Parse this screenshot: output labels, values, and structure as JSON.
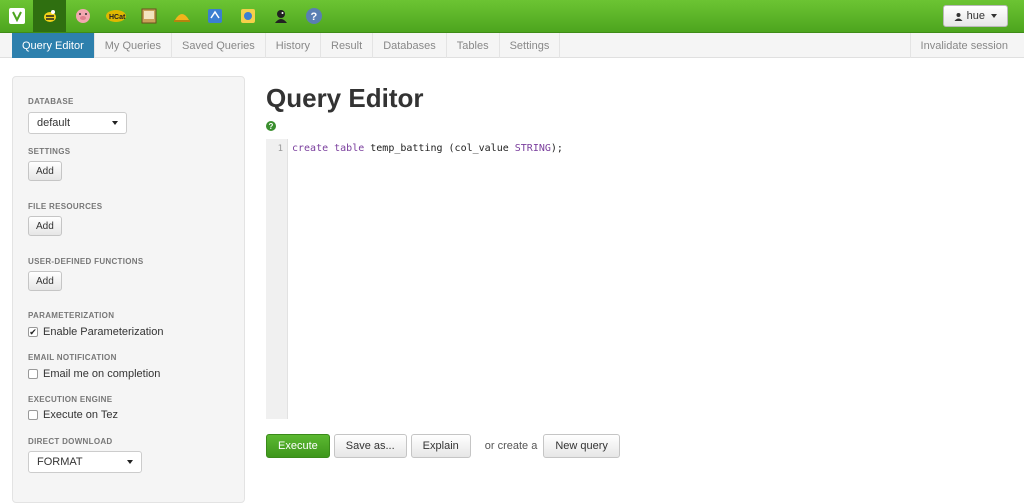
{
  "topbar": {
    "apps": [
      {
        "icon": "hue-home-icon",
        "color": "#ffffff"
      },
      {
        "icon": "beeswax-icon",
        "color": "#f2d21a"
      },
      {
        "icon": "pig-icon",
        "color": "#f3a7b0"
      },
      {
        "icon": "hcat-icon",
        "color": "#e0b800"
      },
      {
        "icon": "file-browser-icon",
        "color": "#c9a15a"
      },
      {
        "icon": "job-designer-icon",
        "color": "#f0b41c"
      },
      {
        "icon": "oozie-icon",
        "color": "#3b7fd1"
      },
      {
        "icon": "metastore-icon",
        "color": "#f5d04a"
      },
      {
        "icon": "user-admin-icon",
        "color": "#222222"
      },
      {
        "icon": "help-icon",
        "color": "#5a7fb3"
      }
    ],
    "user_label": "hue"
  },
  "subnav": {
    "tabs": [
      "Query Editor",
      "My Queries",
      "Saved Queries",
      "History",
      "Result",
      "Databases",
      "Tables",
      "Settings"
    ],
    "active_index": 0,
    "right_label": "Invalidate session"
  },
  "sidebar": {
    "database_label": "DATABASE",
    "database_value": "default",
    "settings_label": "SETTINGS",
    "settings_add": "Add",
    "file_resources_label": "FILE RESOURCES",
    "file_resources_add": "Add",
    "udf_label": "USER-DEFINED FUNCTIONS",
    "udf_add": "Add",
    "parameterization_label": "PARAMETERIZATION",
    "parameterization_check": "Enable Parameterization",
    "email_label": "EMAIL NOTIFICATION",
    "email_check": "Email me on completion",
    "engine_label": "EXECUTION ENGINE",
    "engine_check": "Execute on Tez",
    "download_label": "DIRECT DOWNLOAD",
    "download_value": "FORMAT"
  },
  "main": {
    "title": "Query Editor",
    "line_number": "1",
    "code_kw1": "create table",
    "code_mid": " temp_batting (col_value ",
    "code_kw2": "STRING",
    "code_end": ");",
    "execute": "Execute",
    "save_as": "Save as...",
    "explain": "Explain",
    "or_create": "or create a",
    "new_query": "New query"
  },
  "colors": {
    "topbar_green": "#4da51e",
    "active_tab": "#2d80ad",
    "execute_green": "#3e961c"
  }
}
